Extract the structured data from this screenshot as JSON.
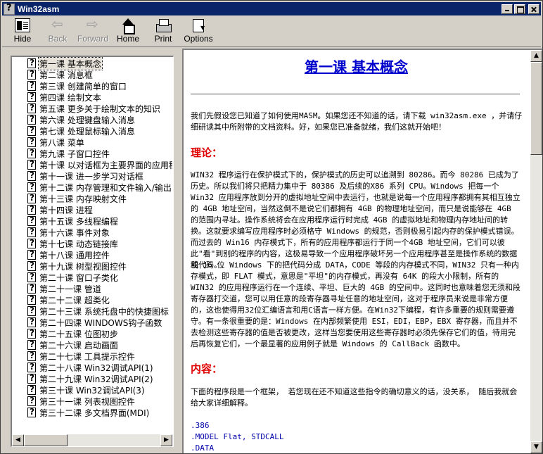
{
  "window": {
    "title": "Win32asm"
  },
  "toolbar": {
    "hide": "Hide",
    "back": "Back",
    "forward": "Forward",
    "home": "Home",
    "print": "Print",
    "options": "Options"
  },
  "toc": [
    "第一课 基本概念",
    "第二课 消息框",
    "第三课 创建简单的窗口",
    "第四课 绘制文本",
    "第五课 更多关于绘制文本的知识",
    "第六课 处理键盘输入消息",
    "第七课 处理鼠标输入消息",
    "第八课 菜单",
    "第九课 子窗口控件",
    "第十课 以对话框为主要界面的应用程",
    "第十一课 进一步学习对话框",
    "第十二课 内存管理和文件输入/输出",
    "第十三课 内存映射文件",
    "第十四课 进程",
    "第十五课 多线程编程",
    "第十六课 事件对象",
    "第十七课 动态链接库",
    "第十八课 通用控件",
    "第十九课 树型视图控件",
    "第二十课 窗口子类化",
    "第二十一课 管道",
    "第二十二课 超类化",
    "第二十三课 系统托盘中的快捷图标",
    "第二十四课 WINDOWS钩子函数",
    "第二十五课 位图初步",
    "第二十六课 启动画面",
    "第二十七课 工具提示控件",
    "第二十八课 Win32调试API(1)",
    "第二十九课 Win32调试API(2)",
    "第三十课 Win32调试API(3)",
    "第三十一课 列表视图控件",
    "第三十二课 多文档界面(MDI)"
  ],
  "document": {
    "title": "第一课 基本概念",
    "intro": "我们先假设您已知道了如何使用MASM。如果您还不知道的话，请下载 win32asm.exe ，并请仔细研读其中所附带的文档资料。好，如果您已准备就绪，我们这就开始吧！",
    "heading_theory": "理论：",
    "theory": "WIN32 程序运行在保护模式下的，保护模式的历史可以追溯到 80286。而今 80286 已成为了历史。所以我们将只把精力集中于 80386 及后续的X86 系列 CPU。Windows 把每一个 Win32 应用程序放到分开的虚拟地址空间中去运行，也就是说每一个应用程序都拥有其相互独立的 4GB 地址空间，当然这倒不是说它们都拥有 4GB 的物理地址空间，而只是说能够在 4GB 的范围内寻址。操作系统将会在应用程序运行时完成 4GB 的虚拟地址和物理内存地址间的转换。这就要求编写应用程序时必须格守 Windows 的规范，否则极易引起内存的保护模式错误。而过去的 Win16 内存模式下，所有的应用程序都运行于同一个4GB 地址空间，它们可以彼此\"看\"到别的程序的内容，这极易导致一个应用程序破坏另一个应用程序甚至是操作系统的数据或代码。",
    "theory2": "和 16 位 Windows 下的把代码分成 DATA，CODE 等段的内存模式不同，WIN32 只有一种内存模式，即 FLAT 模式，意思是\"平坦\"的内存模式，再没有 64K 的段大小限制，所有的 WIN32 的应用程序运行在一个连续、平坦、巨大的 4GB 的空间中。这同时也意味着您无须和段寄存器打交道，您可以用任意的段寄存器寻址任意的地址空间，这对于程序员来说是非常方便的，这也使得用32位汇编语言和用C语言一样方便。在Win32下编程，有许多重要的规则需要遵守。有一条很重要的是：Windows 在内部频繁使用 ESI，EDI，EBP，EBX 寄存器，而且并不去检测这些寄存器的值是否被更改，这样当您要使用这些寄存器时必须先保存它们的值，待用完后再恢复它们，一个最显著的应用例子就是 Windows 的 CallBack 函数中。",
    "heading_content": "内容：",
    "content_intro": "下面的程序段是一个框架， 若您现在还不知道这些指令的确切意义的话，没关系， 随后我就会给大家详细解释。",
    "code": [
      ".386",
      ".MODEL Flat, STDCALL",
      ".DATA"
    ]
  }
}
